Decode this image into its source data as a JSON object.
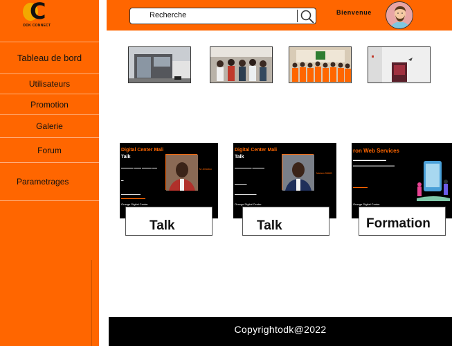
{
  "brand": {
    "logo_text": "ODK CONNECT",
    "accent": "#ff6600",
    "logo_gold": "#f2a900"
  },
  "sidebar": {
    "items": [
      {
        "label": "Tableau de bord",
        "icon": ""
      },
      {
        "label": "Utilisateurs"
      },
      {
        "label": "Promotion"
      },
      {
        "label": "Galerie"
      },
      {
        "label": "Forum"
      },
      {
        "label": "Parametrages"
      }
    ]
  },
  "header": {
    "search": {
      "value": "Recherche",
      "icon": "search-icon"
    },
    "welcome": "Bienvenue",
    "avatar": "user-avatar"
  },
  "gallery": {
    "photos": [
      {
        "name": "building-photo"
      },
      {
        "name": "event-photo"
      },
      {
        "name": "group-photo"
      },
      {
        "name": "office-photo"
      }
    ]
  },
  "cards": [
    {
      "title": "Digital Center Mali",
      "subtitle": "Talk",
      "caption": "Talk",
      "guest": "M. Amadou",
      "org": "Orange Digital Center"
    },
    {
      "title": "Digital Center Mali",
      "subtitle": "Talk",
      "caption": "Talk",
      "guest": "Mariam SAMB",
      "org": "Orange Digital Center"
    },
    {
      "title": "ron Web Services",
      "subtitle": "",
      "caption": "Formation",
      "guest": "",
      "org": "Orange Digital Center"
    }
  ],
  "footer": {
    "copyright": "Copyrightodk@2022"
  }
}
